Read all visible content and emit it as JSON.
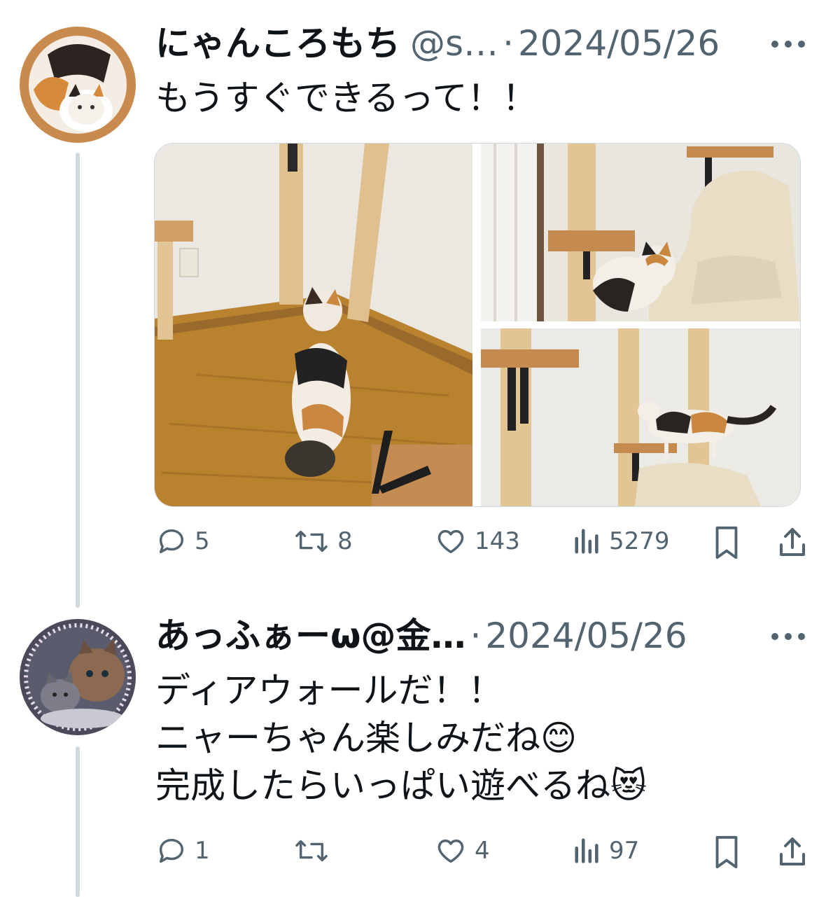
{
  "tweets": [
    {
      "name": "にゃんころもち",
      "handle": "@s…",
      "dot": "·",
      "date": "2024/05/26",
      "text": "もうすぐできるって！！",
      "actions": {
        "replies": "5",
        "retweets": "8",
        "likes": "143",
        "views": "5279"
      }
    },
    {
      "name": "あっふぁーω@金…",
      "dot": "·",
      "date": "2024/05/26",
      "text": "ディアウォールだ！！\nニャーちゃん楽しみだね😊\n完成したらいっぱい遊べるね😻",
      "actions": {
        "replies": "1",
        "retweets": "",
        "likes": "4",
        "views": "97"
      }
    }
  ],
  "icons": [
    "more-icon",
    "reply-icon",
    "retweet-icon",
    "like-icon",
    "views-icon",
    "bookmark-icon",
    "share-icon"
  ],
  "colors": {
    "text": "#0f1419",
    "secondary": "#536471",
    "thread_line": "#cfd9de"
  }
}
